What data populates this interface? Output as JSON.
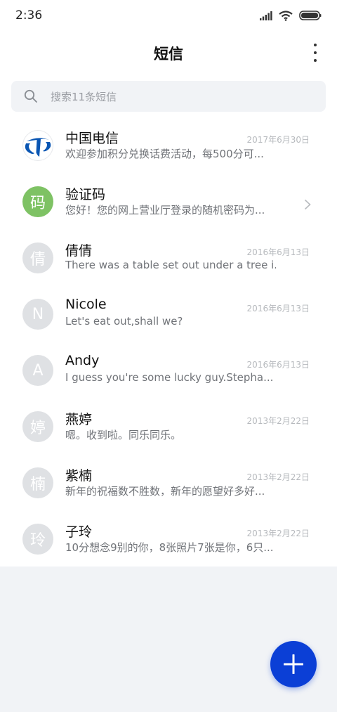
{
  "status_bar": {
    "time": "2:36",
    "icons": [
      "signal-icon",
      "wifi-icon",
      "battery-icon"
    ]
  },
  "header": {
    "title": "短信",
    "menu_icon": "more-vertical-icon"
  },
  "search": {
    "placeholder": "搜索11条短信",
    "icon": "search-icon"
  },
  "conversations": [
    {
      "name": "中国电信",
      "preview": "欢迎参加积分兑换话费活动，每500分可...",
      "date": "2017年6月30日",
      "avatar": "",
      "avatar_type": "logo"
    },
    {
      "name": "验证码",
      "preview": "您好！您的网上营业厅登录的随机密码为...",
      "date": "",
      "avatar": "码",
      "avatar_type": "green",
      "chevron": "chevron-right-icon"
    },
    {
      "name": "倩倩",
      "preview": "There was a table set out under a tree i...",
      "date": "2016年6月13日",
      "avatar": "倩",
      "avatar_type": "grey"
    },
    {
      "name": "Nicole",
      "preview": "Let's eat out,shall we?",
      "date": "2016年6月13日",
      "avatar": "N",
      "avatar_type": "grey"
    },
    {
      "name": "Andy",
      "preview": "I guess you're some lucky guy.Stepha...",
      "date": "2016年6月13日",
      "avatar": "A",
      "avatar_type": "grey"
    },
    {
      "name": "燕婷",
      "preview": "嗯。收到啦。同乐同乐。",
      "date": "2013年2月22日",
      "avatar": "婷",
      "avatar_type": "grey"
    },
    {
      "name": "紫楠",
      "preview": "新年的祝福数不胜数，新年的愿望好多好...",
      "date": "2013年2月22日",
      "avatar": "楠",
      "avatar_type": "grey"
    },
    {
      "name": "子玲",
      "preview": "10分想念9别的你，8张照片7张是你，6只...",
      "date": "2013年2月22日",
      "avatar": "玲",
      "avatar_type": "grey"
    }
  ],
  "fab": {
    "icon": "plus-icon"
  },
  "colors": {
    "accent": "#0b3fd6",
    "verify_avatar": "#7ec264",
    "default_avatar": "#dfe1e4",
    "background": "#f1f3f6"
  }
}
